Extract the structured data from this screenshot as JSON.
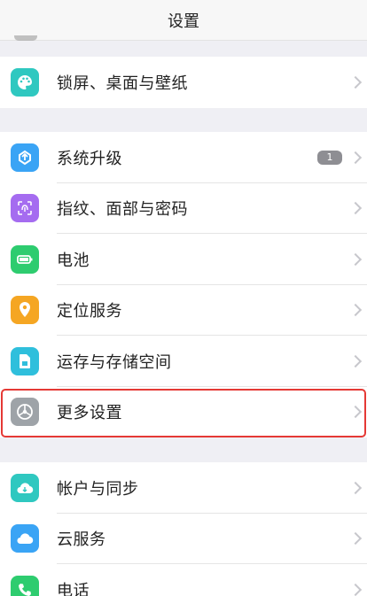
{
  "header": {
    "title": "设置"
  },
  "group1": [
    {
      "label": "锁屏、桌面与壁纸",
      "icon": "palette-icon",
      "color": "#2fc8c0"
    }
  ],
  "group2": [
    {
      "label": "系统升级",
      "icon": "upgrade-icon",
      "color": "#3aa4f5",
      "badge": "1"
    },
    {
      "label": "指纹、面部与密码",
      "icon": "fingerprint-icon",
      "color": "#a56cf0"
    },
    {
      "label": "电池",
      "icon": "battery-icon",
      "color": "#2ecc6f"
    },
    {
      "label": "定位服务",
      "icon": "location-icon",
      "color": "#f5a623"
    },
    {
      "label": "运存与存储空间",
      "icon": "storage-icon",
      "color": "#2fbfdc"
    },
    {
      "label": "更多设置",
      "icon": "gear-icon",
      "color": "#9ea3a8"
    }
  ],
  "group3": [
    {
      "label": "帐户与同步",
      "icon": "account-sync-icon",
      "color": "#2fc8c0"
    },
    {
      "label": "云服务",
      "icon": "cloud-icon",
      "color": "#3aa4f5"
    },
    {
      "label": "电话",
      "icon": "phone-icon",
      "color": "#2ecc6f"
    }
  ]
}
